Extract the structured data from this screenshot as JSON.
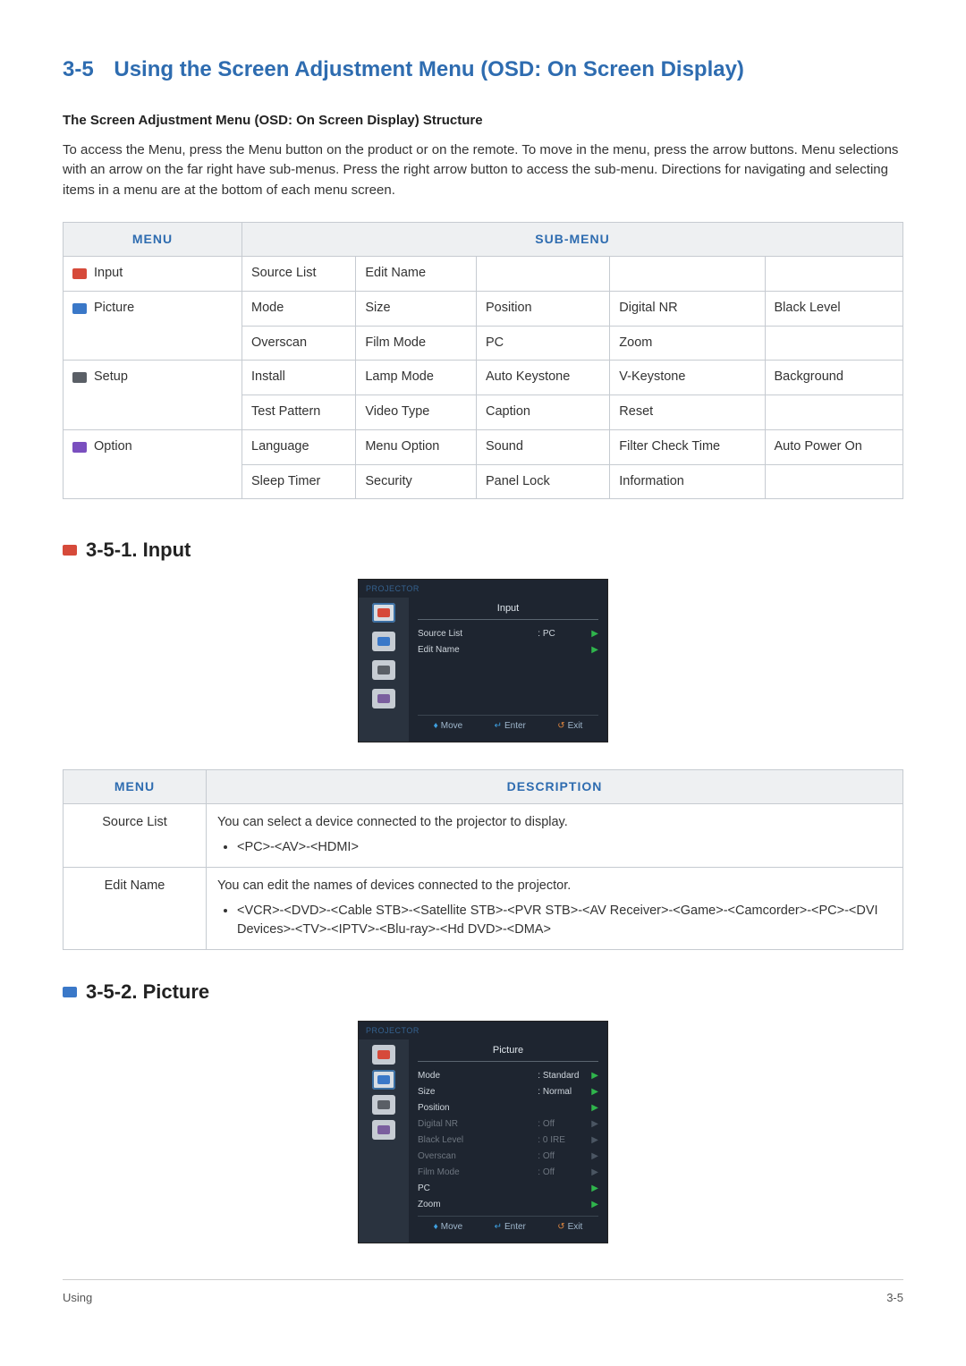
{
  "header": {
    "number": "3-5",
    "title": "Using the Screen Adjustment Menu (OSD: On Screen Display)"
  },
  "structure_heading": "The Screen Adjustment Menu (OSD: On Screen Display) Structure",
  "intro": "To access the Menu, press the Menu button on the product or on the remote. To move in the menu, press the arrow buttons. Menu selections with an arrow on the far right have sub-menus. Press the right arrow button to access the sub-menu. Directions for navigating and selecting items in a menu are at the bottom of each menu screen.",
  "osd_table": {
    "head_menu": "MENU",
    "head_sub": "SUB-MENU",
    "rows": {
      "input": {
        "label": "Input",
        "r1": [
          "Source List",
          "Edit Name",
          "",
          "",
          ""
        ]
      },
      "picture": {
        "label": "Picture",
        "r1": [
          "Mode",
          "Size",
          "Position",
          "Digital NR",
          "Black Level"
        ],
        "r2": [
          "Overscan",
          "Film Mode",
          "PC",
          "Zoom",
          ""
        ]
      },
      "setup": {
        "label": "Setup",
        "r1": [
          "Install",
          "Lamp Mode",
          "Auto Keystone",
          "V-Keystone",
          "Background"
        ],
        "r2": [
          "Test Pattern",
          "Video Type",
          "Caption",
          "Reset",
          ""
        ]
      },
      "option": {
        "label": "Option",
        "r1": [
          "Language",
          "Menu Option",
          "Sound",
          "Filter Check Time",
          "Auto Power On"
        ],
        "r2": [
          "Sleep Timer",
          "Security",
          "Panel Lock",
          "Information",
          ""
        ]
      }
    }
  },
  "section_351": {
    "heading": "3-5-1. Input",
    "osd": {
      "brand": "PROJECTOR",
      "title": "Input",
      "items": [
        {
          "label": "Source List",
          "value": ": PC"
        },
        {
          "label": "Edit Name",
          "value": ""
        }
      ],
      "footer": {
        "move": "Move",
        "enter": "Enter",
        "exit": "Exit"
      }
    },
    "desc_table": {
      "head_menu": "MENU",
      "head_desc": "DESCRIPTION",
      "rows": [
        {
          "label": "Source List",
          "text": "You can select a device connected to the projector to display.",
          "bullet": "<PC>-<AV>-<HDMI>"
        },
        {
          "label": "Edit Name",
          "text": "You can edit the names of devices connected to the projector.",
          "bullet": "<VCR>-<DVD>-<Cable STB>-<Satellite STB>-<PVR STB>-<AV Receiver>-<Game>-<Camcorder>-<PC>-<DVI Devices>-<TV>-<IPTV>-<Blu-ray>-<Hd DVD>-<DMA>"
        }
      ]
    }
  },
  "section_352": {
    "heading": "3-5-2. Picture",
    "osd": {
      "brand": "PROJECTOR",
      "title": "Picture",
      "items": [
        {
          "label": "Mode",
          "value": ": Standard",
          "dim": false
        },
        {
          "label": "Size",
          "value": ": Normal",
          "dim": false
        },
        {
          "label": "Position",
          "value": "",
          "dim": false
        },
        {
          "label": "Digital NR",
          "value": ": Off",
          "dim": true
        },
        {
          "label": "Black Level",
          "value": ": 0 IRE",
          "dim": true
        },
        {
          "label": "Overscan",
          "value": ": Off",
          "dim": true
        },
        {
          "label": "Film Mode",
          "value": ": Off",
          "dim": true
        },
        {
          "label": "PC",
          "value": "",
          "dim": false
        },
        {
          "label": "Zoom",
          "value": "",
          "dim": false
        }
      ],
      "footer": {
        "move": "Move",
        "enter": "Enter",
        "exit": "Exit"
      }
    }
  },
  "footer": {
    "left": "Using",
    "right": "3-5"
  }
}
